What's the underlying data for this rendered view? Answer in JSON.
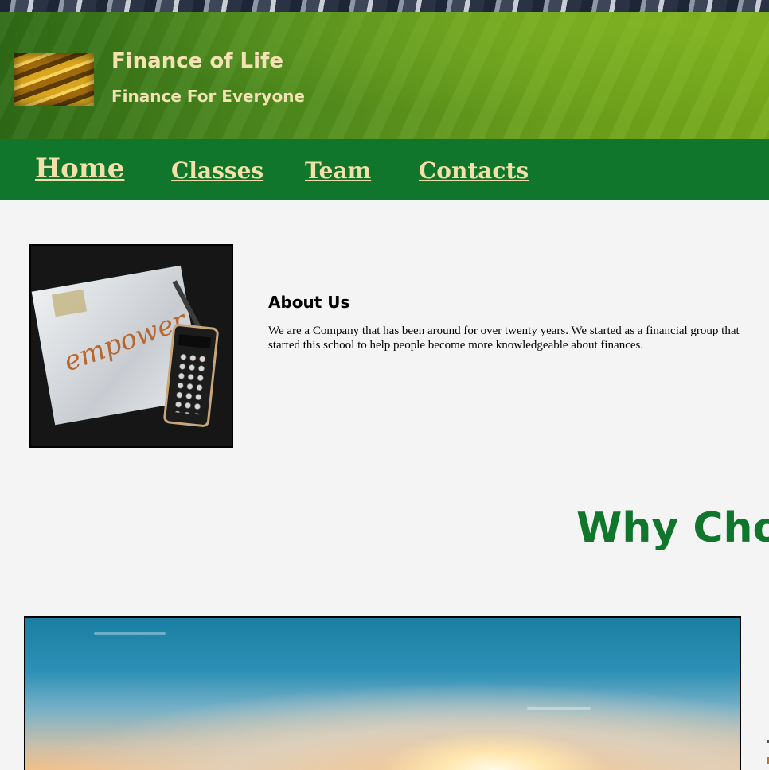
{
  "header": {
    "title": "Finance of Life",
    "tagline": "Finance For Everyone"
  },
  "nav": {
    "items": [
      {
        "label": "Home"
      },
      {
        "label": "Classes"
      },
      {
        "label": "Team"
      },
      {
        "label": "Contacts"
      }
    ]
  },
  "about": {
    "image_text": "empower",
    "heading": "About Us",
    "line1": "We are a Company that has been around for over twenty years. We started as a financial group that",
    "line2": "started this school to help people become more knowledgeable about finances."
  },
  "why": {
    "heading": "Why Cho"
  },
  "colors": {
    "brand_green": "#0f762b",
    "nav_link": "#f3dfa8",
    "header_text": "#f3e2b2",
    "background": "#f4f4f4"
  }
}
